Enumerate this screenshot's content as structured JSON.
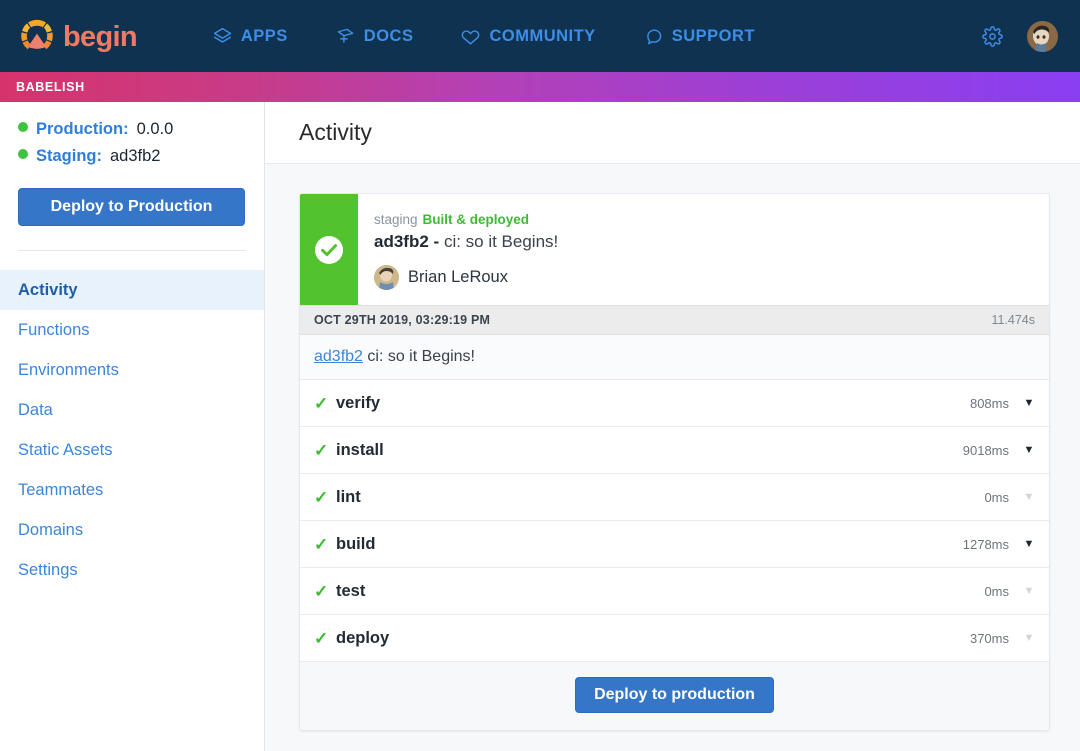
{
  "topnav": {
    "brand": {
      "word": "begin",
      "icon": "begin-logo-icon"
    },
    "links": [
      {
        "label": "APPS",
        "icon": "layers-icon"
      },
      {
        "label": "DOCS",
        "icon": "book-icon"
      },
      {
        "label": "COMMUNITY",
        "icon": "heart-icon"
      },
      {
        "label": "SUPPORT",
        "icon": "chat-bubble-icon"
      }
    ],
    "settings_icon": "gear-icon",
    "avatar": "user-avatar"
  },
  "appbar": {
    "app_name": "BABELISH",
    "gradient_from": "#d6336c",
    "gradient_to": "#8a3ff2"
  },
  "sidebar": {
    "environments": [
      {
        "label": "Production:",
        "value": "0.0.0",
        "status_color": "#3fc23f"
      },
      {
        "label": "Staging:",
        "value": "ad3fb2",
        "status_color": "#3fc23f"
      }
    ],
    "deploy_button": "Deploy to Production",
    "nav": [
      {
        "label": "Activity",
        "active": true
      },
      {
        "label": "Functions",
        "active": false
      },
      {
        "label": "Environments",
        "active": false
      },
      {
        "label": "Data",
        "active": false
      },
      {
        "label": "Static Assets",
        "active": false
      },
      {
        "label": "Teammates",
        "active": false
      },
      {
        "label": "Domains",
        "active": false
      },
      {
        "label": "Settings",
        "active": false
      }
    ]
  },
  "main": {
    "title": "Activity",
    "card": {
      "status_color": "#52c22e",
      "status_icon": "check-circle-icon",
      "env": "staging",
      "state": "Built & deployed",
      "commit_sha": "ad3fb2",
      "commit_sep": "-",
      "commit_message": "ci: so it Begins!",
      "author": "Brian LeRoux",
      "timestamp": "OCT 29TH 2019, 03:29:19 PM",
      "total_duration": "11.474s",
      "message_sha": "ad3fb2",
      "message_text": "ci: so it Begins!",
      "steps": [
        {
          "name": "verify",
          "duration": "808ms",
          "status": "ok",
          "expandable": true
        },
        {
          "name": "install",
          "duration": "9018ms",
          "status": "ok",
          "expandable": true
        },
        {
          "name": "lint",
          "duration": "0ms",
          "status": "ok",
          "expandable": false
        },
        {
          "name": "build",
          "duration": "1278ms",
          "status": "ok",
          "expandable": true
        },
        {
          "name": "test",
          "duration": "0ms",
          "status": "ok",
          "expandable": false
        },
        {
          "name": "deploy",
          "duration": "370ms",
          "status": "ok",
          "expandable": false
        }
      ],
      "step_check_glyph": "✓",
      "caret_glyph": "▼",
      "footer_button": "Deploy to production"
    }
  }
}
